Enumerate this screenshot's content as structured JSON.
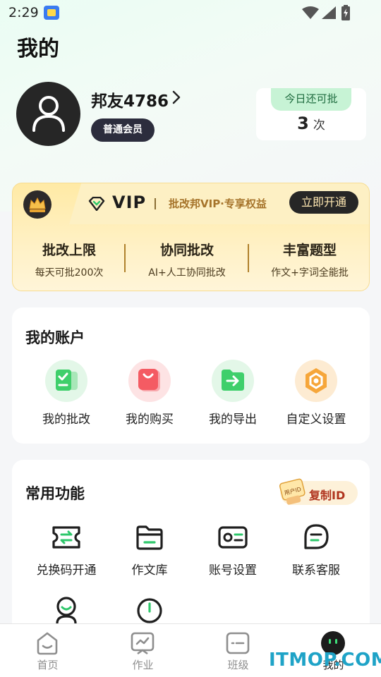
{
  "status_bar": {
    "time": "2:29"
  },
  "page": {
    "title": "我的"
  },
  "profile": {
    "username": "邦友4786",
    "member_level": "普通会员",
    "quota_label": "今日还可批",
    "quota_count": "3",
    "quota_unit": "次"
  },
  "vip": {
    "title": "VIP",
    "slogan": "批改邦VIP·专享权益",
    "open_button": "立即开通",
    "features": [
      {
        "title": "批改上限",
        "desc": "每天可批200次"
      },
      {
        "title": "协同批改",
        "desc": "AI+人工协同批改"
      },
      {
        "title": "丰富题型",
        "desc": "作文+字词全能批"
      }
    ]
  },
  "account": {
    "title": "我的账户",
    "items": [
      {
        "label": "我的批改",
        "icon": "check-document-icon",
        "color": "#3fcf6b"
      },
      {
        "label": "我的购买",
        "icon": "shopping-bag-icon",
        "color": "#f45b63"
      },
      {
        "label": "我的导出",
        "icon": "export-folder-icon",
        "color": "#3fcf6b"
      },
      {
        "label": "自定义设置",
        "icon": "hexagon-settings-icon",
        "color": "#f6a63a"
      }
    ]
  },
  "tools": {
    "title": "常用功能",
    "copy_id_label": "复制ID",
    "copy_id_tag": "用户ID",
    "items": [
      {
        "label": "兑换码开通",
        "icon": "exchange-ticket-icon"
      },
      {
        "label": "作文库",
        "icon": "folder-icon"
      },
      {
        "label": "账号设置",
        "icon": "id-card-icon"
      },
      {
        "label": "联系客服",
        "icon": "chat-bubble-icon"
      },
      {
        "label": "",
        "icon": "user-support-icon"
      },
      {
        "label": "",
        "icon": "clock-icon"
      }
    ]
  },
  "tab_bar": {
    "tabs": [
      {
        "label": "首页",
        "icon": "home-icon"
      },
      {
        "label": "作业",
        "icon": "homework-icon"
      },
      {
        "label": "班级",
        "icon": "class-icon"
      },
      {
        "label": "我的",
        "icon": "mine-icon"
      }
    ],
    "active": 3
  },
  "watermark": "ITMOP.COM"
}
